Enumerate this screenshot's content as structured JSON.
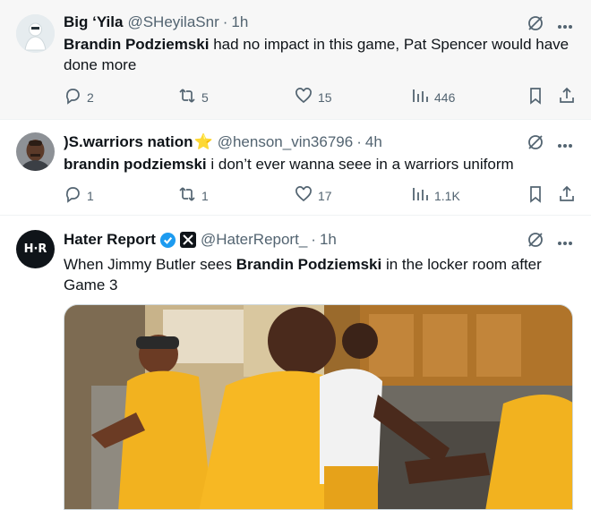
{
  "tweets": [
    {
      "name": "Big ‘Yila",
      "handle": "@SHeyilaSnr",
      "sep": "·",
      "time": "1h",
      "text_bold": "Brandin Podziemski",
      "text_rest": " had no impact in this game, Pat Spencer would have done more",
      "replies": "2",
      "retweets": "5",
      "likes": "15",
      "views": "446"
    },
    {
      "name": ")S.warriors nation",
      "name_emoji": "⭐",
      "handle": "@henson_vin36796",
      "sep": "·",
      "time": "4h",
      "text_bold": "brandin podziemski",
      "text_rest": " i don’t ever wanna seee in a warriors uniform",
      "replies": "1",
      "retweets": "1",
      "likes": "17",
      "views": "1.1K"
    },
    {
      "name": "Hater Report",
      "handle": "@HaterReport_",
      "sep": "·",
      "time": "1h",
      "avatar_text": "H·R",
      "text_pre": "When Jimmy Butler sees ",
      "text_bold": "Brandin Podziemski",
      "text_post": " in the locker room after Game 3"
    }
  ],
  "icons": {
    "grok": "grok-icon",
    "more": "more-icon",
    "reply": "reply-icon",
    "retweet": "retweet-icon",
    "like": "like-icon",
    "views": "views-icon",
    "bookmark": "bookmark-icon",
    "share": "share-icon"
  },
  "colors": {
    "text": "#0f1419",
    "muted": "#536471",
    "verified": "#1d9bf0",
    "star": "#f4b400"
  }
}
